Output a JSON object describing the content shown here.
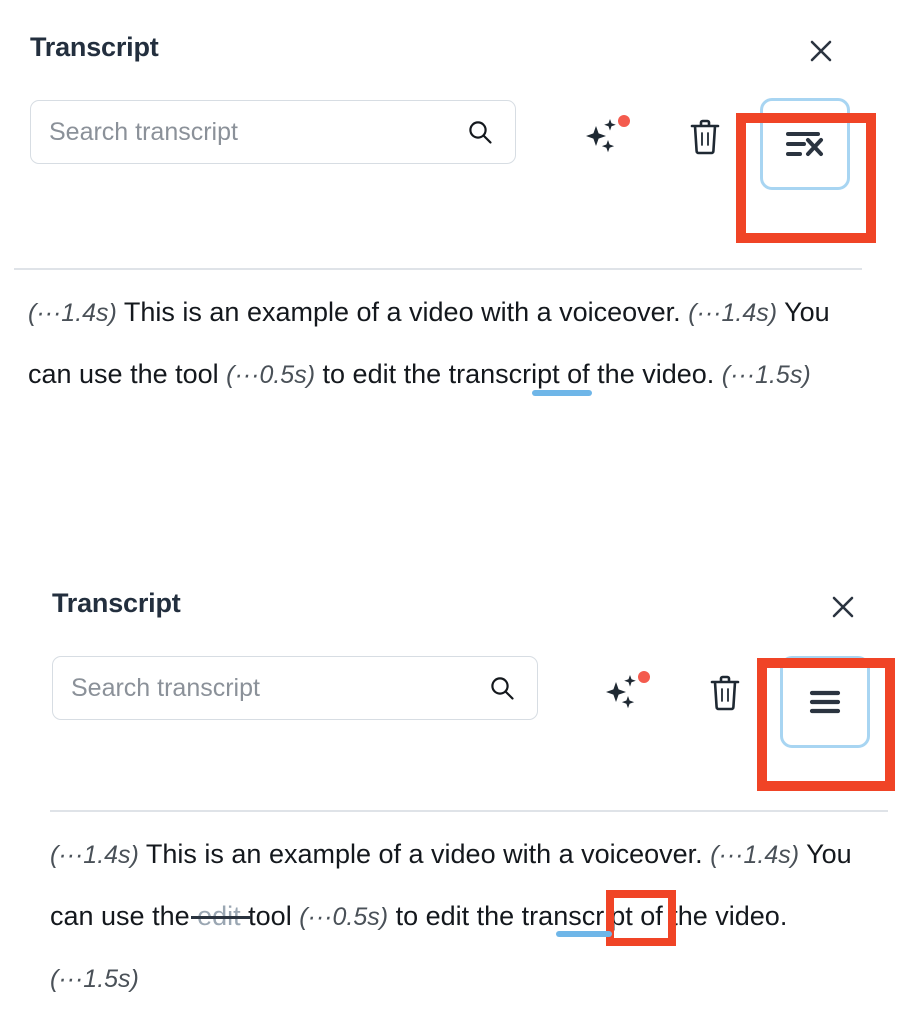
{
  "panels": [
    {
      "title": "Transcript",
      "close_label": "×",
      "search": {
        "placeholder": "Search transcript",
        "value": ""
      },
      "toolbar": {
        "sparkle_icon": "ai-sparkle-icon",
        "sparkle_badge": "notification-dot",
        "trash_icon": "trash-icon",
        "toggle_icon": "hide-filler-words-icon",
        "toggle_state": "active"
      },
      "transcript": {
        "segments": [
          {
            "type": "pause",
            "text": "(···1.4s)"
          },
          {
            "type": "text",
            "text": " This is an example of a video with a voiceover. "
          },
          {
            "type": "pause",
            "text": "(···1.4s)"
          },
          {
            "type": "text",
            "text": " You can use the tool "
          },
          {
            "type": "pause",
            "text": "(···0.5s)"
          },
          {
            "type": "text",
            "text": " to edit the transcript of the video. "
          },
          {
            "type": "pause",
            "text": "(···1.5s)"
          }
        ]
      }
    },
    {
      "title": "Transcript",
      "close_label": "×",
      "search": {
        "placeholder": "Search transcript",
        "value": ""
      },
      "toolbar": {
        "sparkle_icon": "ai-sparkle-icon",
        "sparkle_badge": "notification-dot",
        "trash_icon": "trash-icon",
        "toggle_icon": "show-all-words-icon",
        "toggle_state": "active"
      },
      "transcript": {
        "segments": [
          {
            "type": "pause",
            "text": "(···1.4s)"
          },
          {
            "type": "text",
            "text": " This is an example of a video with a voiceover. "
          },
          {
            "type": "pause",
            "text": "(···1.4s)"
          },
          {
            "type": "text",
            "text": " You can use the "
          },
          {
            "type": "struck",
            "text": "edit"
          },
          {
            "type": "text",
            "text": " tool "
          },
          {
            "type": "pause",
            "text": "(···0.5s)"
          },
          {
            "type": "text",
            "text": " to edit the transcript of the video. "
          },
          {
            "type": "pause",
            "text": "(···1.5s)"
          }
        ]
      }
    }
  ],
  "annotations": {
    "highlight_color": "#f04426",
    "focus_ring_color": "#a8d5f2",
    "caret_color": "#6fb6e8",
    "badge_color": "#f45b4e"
  },
  "colors": {
    "title": "#232f3e",
    "body_text": "#14181d",
    "pause_text": "#4a5158",
    "struck_text": "#9aa6b2",
    "placeholder": "#8b9199",
    "border": "#d7dde3",
    "divider": "#dfe3e8"
  }
}
